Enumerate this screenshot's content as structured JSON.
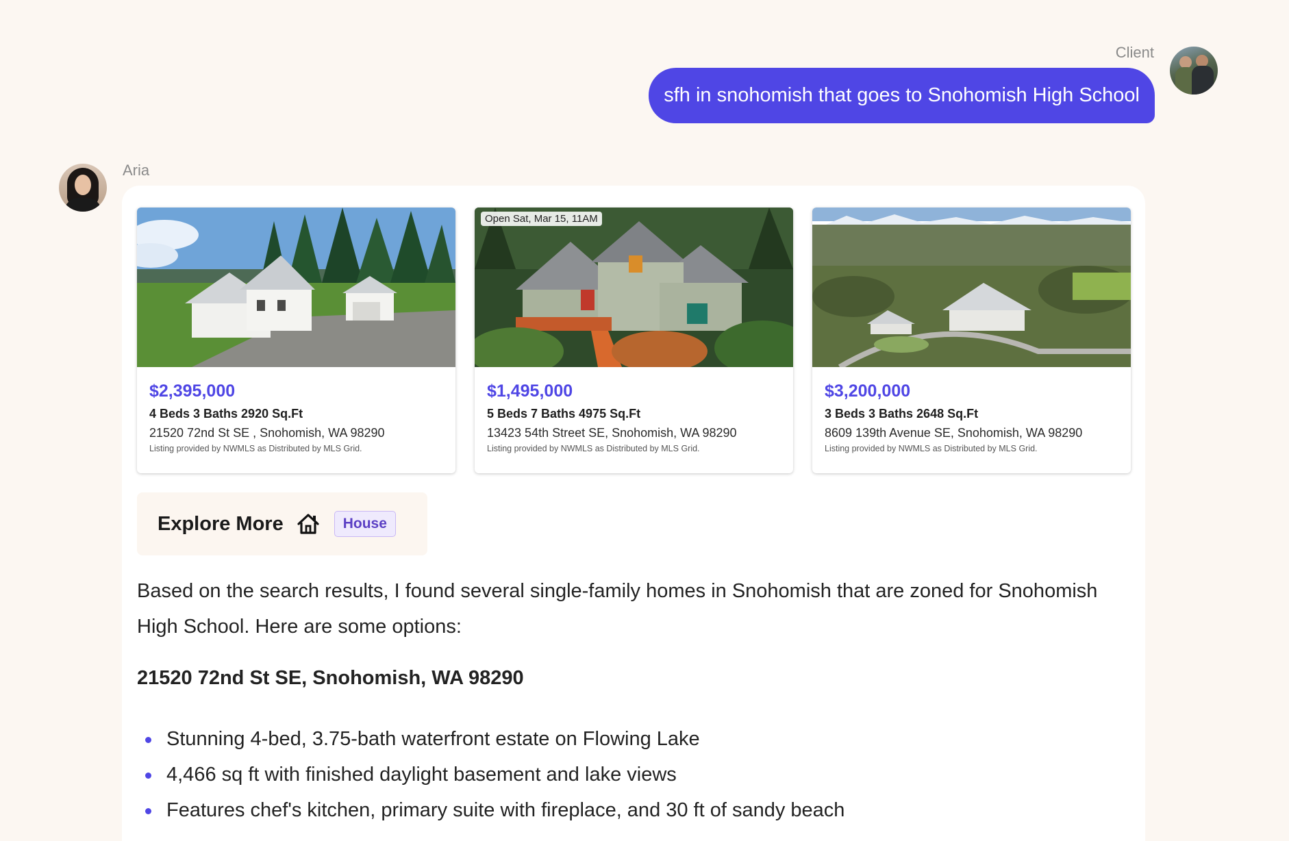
{
  "user_message": {
    "sender": "Client",
    "text": "sfh in snohomish that goes to Snohomish High School"
  },
  "assistant": {
    "name": "Aria",
    "listings": [
      {
        "price": "$2,395,000",
        "specs": "4 Beds 3 Baths 2920 Sq.Ft",
        "address": "21520 72nd St SE , Snohomish, WA 98290",
        "disclaimer": "Listing provided by NWMLS as Distributed by MLS Grid.",
        "badge": ""
      },
      {
        "price": "$1,495,000",
        "specs": "5 Beds 7 Baths 4975 Sq.Ft",
        "address": "13423 54th Street SE, Snohomish, WA 98290",
        "disclaimer": "Listing provided by NWMLS as Distributed by MLS Grid.",
        "badge": "Open Sat, Mar 15, 11AM"
      },
      {
        "price": "$3,200,000",
        "specs": "3 Beds 3 Baths 2648 Sq.Ft",
        "address": "8609 139th Avenue SE, Snohomish, WA 98290",
        "disclaimer": "Listing provided by NWMLS as Distributed by MLS Grid.",
        "badge": ""
      }
    ],
    "explore": {
      "label": "Explore More",
      "icon": "house-icon",
      "tag": "House"
    },
    "intro": "Based on the search results, I found several single-family homes in Snohomish that are zoned for Snohomish High School. Here are some options:",
    "section_title": "21520 72nd St SE, Snohomish, WA 98290",
    "bullets": [
      "Stunning 4-bed, 3.75-bath waterfront estate on Flowing Lake",
      "4,466 sq ft with finished daylight basement and lake views",
      "Features chef's kitchen, primary suite with fireplace, and 30 ft of sandy beach"
    ]
  },
  "colors": {
    "accent": "#4f46e5",
    "background": "#fcf7f2",
    "tag_bg": "#efeafd",
    "tag_text": "#5b3fc4"
  }
}
